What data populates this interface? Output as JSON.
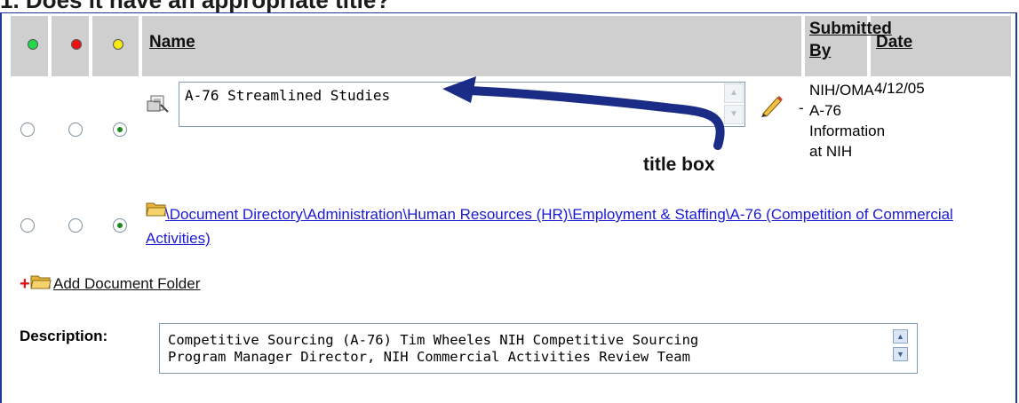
{
  "heading": "1.  Does it have an appropriate title?",
  "table": {
    "header": {
      "name": "Name",
      "submitted_by": "Submitted By",
      "date": "Date"
    },
    "status_colors": {
      "green": "#22d84a",
      "red": "#ee1111",
      "yellow": "#f5ea12"
    },
    "row1": {
      "title_value": "A-76 Streamlined Studies",
      "submitted_by_lines": [
        "NIH/OMA -",
        "A-76",
        "Information",
        "at NIH"
      ],
      "date": "4/12/05",
      "selected_radio": 3
    },
    "row2": {
      "folder_path": "\\Document Directory\\Administration\\Human Resources (HR)\\Employment & Staffing\\A-76 (Competition of Commercial Activities)",
      "selected_radio": 3
    }
  },
  "annotation": "title box",
  "add_folder_label": "Add Document Folder",
  "description": {
    "label": "Description:",
    "lines": [
      "Competitive Sourcing (A-76) Tim Wheeles NIH Competitive Sourcing",
      "Program Manager Director, NIH Commercial Activities Review Team"
    ]
  },
  "icons": [
    "document-icon",
    "edit-pencil-icon",
    "folder-icon",
    "add-folder-icon"
  ],
  "link_color": "#1a1ad4"
}
